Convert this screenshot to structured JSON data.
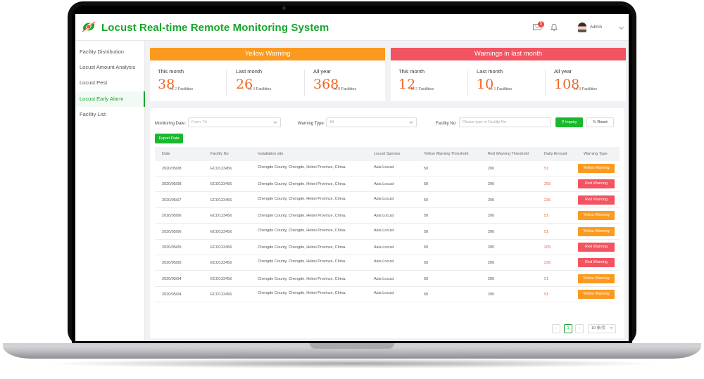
{
  "app": {
    "title": "Locust Real-time Remote Monitoring System"
  },
  "header": {
    "mail_badge": "5",
    "user": "Admin"
  },
  "sidebar": {
    "items": [
      {
        "label": "Facility Distribution"
      },
      {
        "label": "Locust Amount Analysis"
      },
      {
        "label": "Locust Pest"
      },
      {
        "label": "Locust Early Alarm"
      },
      {
        "label": "Facility List"
      }
    ]
  },
  "yellow_panel": {
    "title": "Yellow Warning",
    "stats": [
      {
        "label": "This month",
        "value": "38",
        "pre": "In ",
        "count": "2",
        "post": " Facilities"
      },
      {
        "label": "Last month",
        "value": "26",
        "pre": "In ",
        "count": "3",
        "post": " Facilities"
      },
      {
        "label": "All year",
        "value": "368",
        "pre": "In ",
        "count": "8",
        "post": " Facilities"
      }
    ]
  },
  "red_panel": {
    "title": "Warnings in last month",
    "stats": [
      {
        "label": "This month",
        "value": "12",
        "pre": "In ",
        "count": "2",
        "post": " Facilities"
      },
      {
        "label": "Last month",
        "value": "10",
        "pre": "In ",
        "count": "3",
        "post": " Facilities"
      },
      {
        "label": "All year",
        "value": "108",
        "pre": "In ",
        "count": "8",
        "post": " Facilities"
      }
    ]
  },
  "filters": {
    "date_label": "Monitoring Date:",
    "date_placeholder": "From- To",
    "type_label": "Warning Type:",
    "type_placeholder": "All",
    "facility_label": "Facility No:",
    "facility_placeholder": "Please type in Facility No",
    "inquiry": "Inquiry",
    "reset": "Reset",
    "export": "Export Data"
  },
  "table": {
    "columns": [
      "Date",
      "Facility No",
      "Installation site",
      "Locust Species",
      "Yellow Warning Threshold",
      "Red Warning Threshold",
      "Daily Amount",
      "Warning Type"
    ],
    "rows": [
      {
        "date": "2020/05/08",
        "facility": "ECO123456",
        "site": "Chengde County, Chengde, Hebei Province, China.",
        "species": "Asia Locust",
        "yellow": "50",
        "red": "200",
        "amount": "51",
        "type": "Yellow Warning"
      },
      {
        "date": "2020/05/08",
        "facility": "ECO123456",
        "site": "Chengde County, Chengde, Hebei Province, China.",
        "species": "Asia Locust",
        "yellow": "50",
        "red": "200",
        "amount": "205",
        "type": "Red Warning"
      },
      {
        "date": "2020/05/07",
        "facility": "ECO123456",
        "site": "Chengde County, Chengde, Hebei Province, China.",
        "species": "Asia Locust",
        "yellow": "50",
        "red": "200",
        "amount": "236",
        "type": "Red Warning"
      },
      {
        "date": "2020/05/06",
        "facility": "ECO123456",
        "site": "Chengde County, Chengde, Hebei Province, China.",
        "species": "Asia Locust",
        "yellow": "50",
        "red": "200",
        "amount": "51",
        "type": "Yellow Warning"
      },
      {
        "date": "2020/05/06",
        "facility": "ECO123456",
        "site": "Chengde County, Chengde, Hebei Province, China.",
        "species": "Asia Locust",
        "yellow": "50",
        "red": "200",
        "amount": "51",
        "type": "Yellow Warning"
      },
      {
        "date": "2020/05/05",
        "facility": "ECO123456",
        "site": "Chengde County, Chengde, Hebei Province, China.",
        "species": "Asia Locust",
        "yellow": "50",
        "red": "200",
        "amount": "205",
        "type": "Red Warning"
      },
      {
        "date": "2020/05/05",
        "facility": "ECO123456",
        "site": "Chengde County, Chengde, Hebei Province, China.",
        "species": "Asia Locust",
        "yellow": "50",
        "red": "200",
        "amount": "236",
        "type": "Red Warning"
      },
      {
        "date": "2020/05/04",
        "facility": "ECO123456",
        "site": "Chengde County, Chengde, Hebei Province, China.",
        "species": "Asia Locust",
        "yellow": "50",
        "red": "200",
        "amount": "51",
        "type": "Yellow Warning"
      },
      {
        "date": "2020/05/04",
        "facility": "ECO123456",
        "site": "Chengde County, Chengde, Hebei Province, China.",
        "species": "Asia Locust",
        "yellow": "50",
        "red": "200",
        "amount": "51",
        "type": "Yellow Warning"
      }
    ]
  },
  "pagination": {
    "prev": "‹",
    "page": "1",
    "next": "›",
    "page_size": "10 条/页"
  },
  "colors": {
    "brand": "#17a52d",
    "yellow": "#fb9a1f",
    "red": "#f25461",
    "number": "#f26522"
  }
}
